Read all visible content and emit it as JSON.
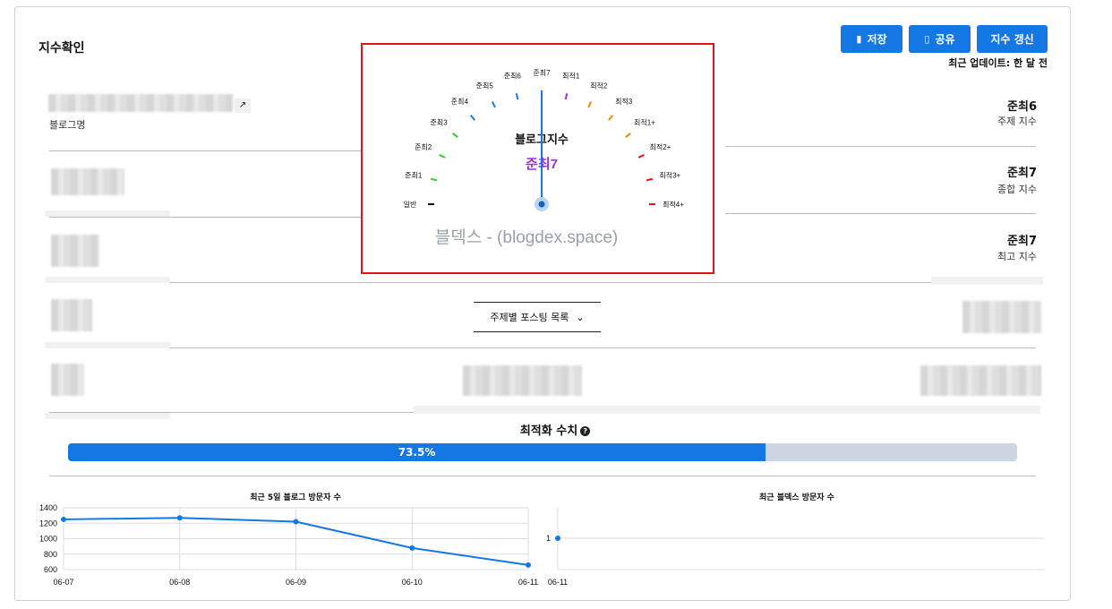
{
  "header": {
    "title": "지수확인",
    "buttons": {
      "save": "저장",
      "share": "공유",
      "refresh": "지수 갱신"
    },
    "updated": "최근 업데이트: 한 달 전"
  },
  "blog": {
    "name_label": "블로그명"
  },
  "gauge": {
    "title": "블로그지수",
    "value": "준최7",
    "watermark": "블덱스 - (blogdex.space)",
    "labels": [
      "일반",
      "준최1",
      "준최2",
      "준최3",
      "준최4",
      "준최5",
      "준최6",
      "준최7",
      "최적1",
      "최적2",
      "최적3",
      "최적1+",
      "최적2+",
      "최적3+",
      "최적4+"
    ],
    "tick_colors": [
      "#111111",
      "#2ecc2e",
      "#2ecc2e",
      "#2ecc2e",
      "#1a73e8",
      "#1a73e8",
      "#1a73e8",
      "#9b30d9",
      "#9b30d9",
      "#f08a00",
      "#f08a00",
      "#f08a00",
      "#e0141a",
      "#e0141a",
      "#e0141a"
    ],
    "needle_index": 7
  },
  "indices": [
    {
      "value": "준최6",
      "label": "주제 지수",
      "color": "#1a5fb4"
    },
    {
      "value": "준최7",
      "label": "종합 지수",
      "color": "#9b30d9"
    },
    {
      "value": "준최7",
      "label": "최고 지수",
      "color": "#9b30d9"
    }
  ],
  "topic_dropdown": "주제별 포스팅 목록",
  "optimization": {
    "title": "최적화 수치",
    "percent_text": "73.5%",
    "fraction": 0.735
  },
  "chart_data": [
    {
      "type": "line",
      "title": "최근 5일 블로그 방문자 수",
      "categories": [
        "06-07",
        "06-08",
        "06-09",
        "06-10",
        "06-11"
      ],
      "values": [
        1250,
        1270,
        1220,
        880,
        660
      ],
      "ylim": [
        600,
        1400
      ],
      "yticks": [
        600,
        800,
        1000,
        1200,
        1400
      ],
      "grid": true
    },
    {
      "type": "line",
      "title": "최근 블덱스 방문자 수",
      "categories": [
        "06-11"
      ],
      "values": [
        1
      ],
      "yticks": [
        1
      ],
      "grid": true
    }
  ]
}
